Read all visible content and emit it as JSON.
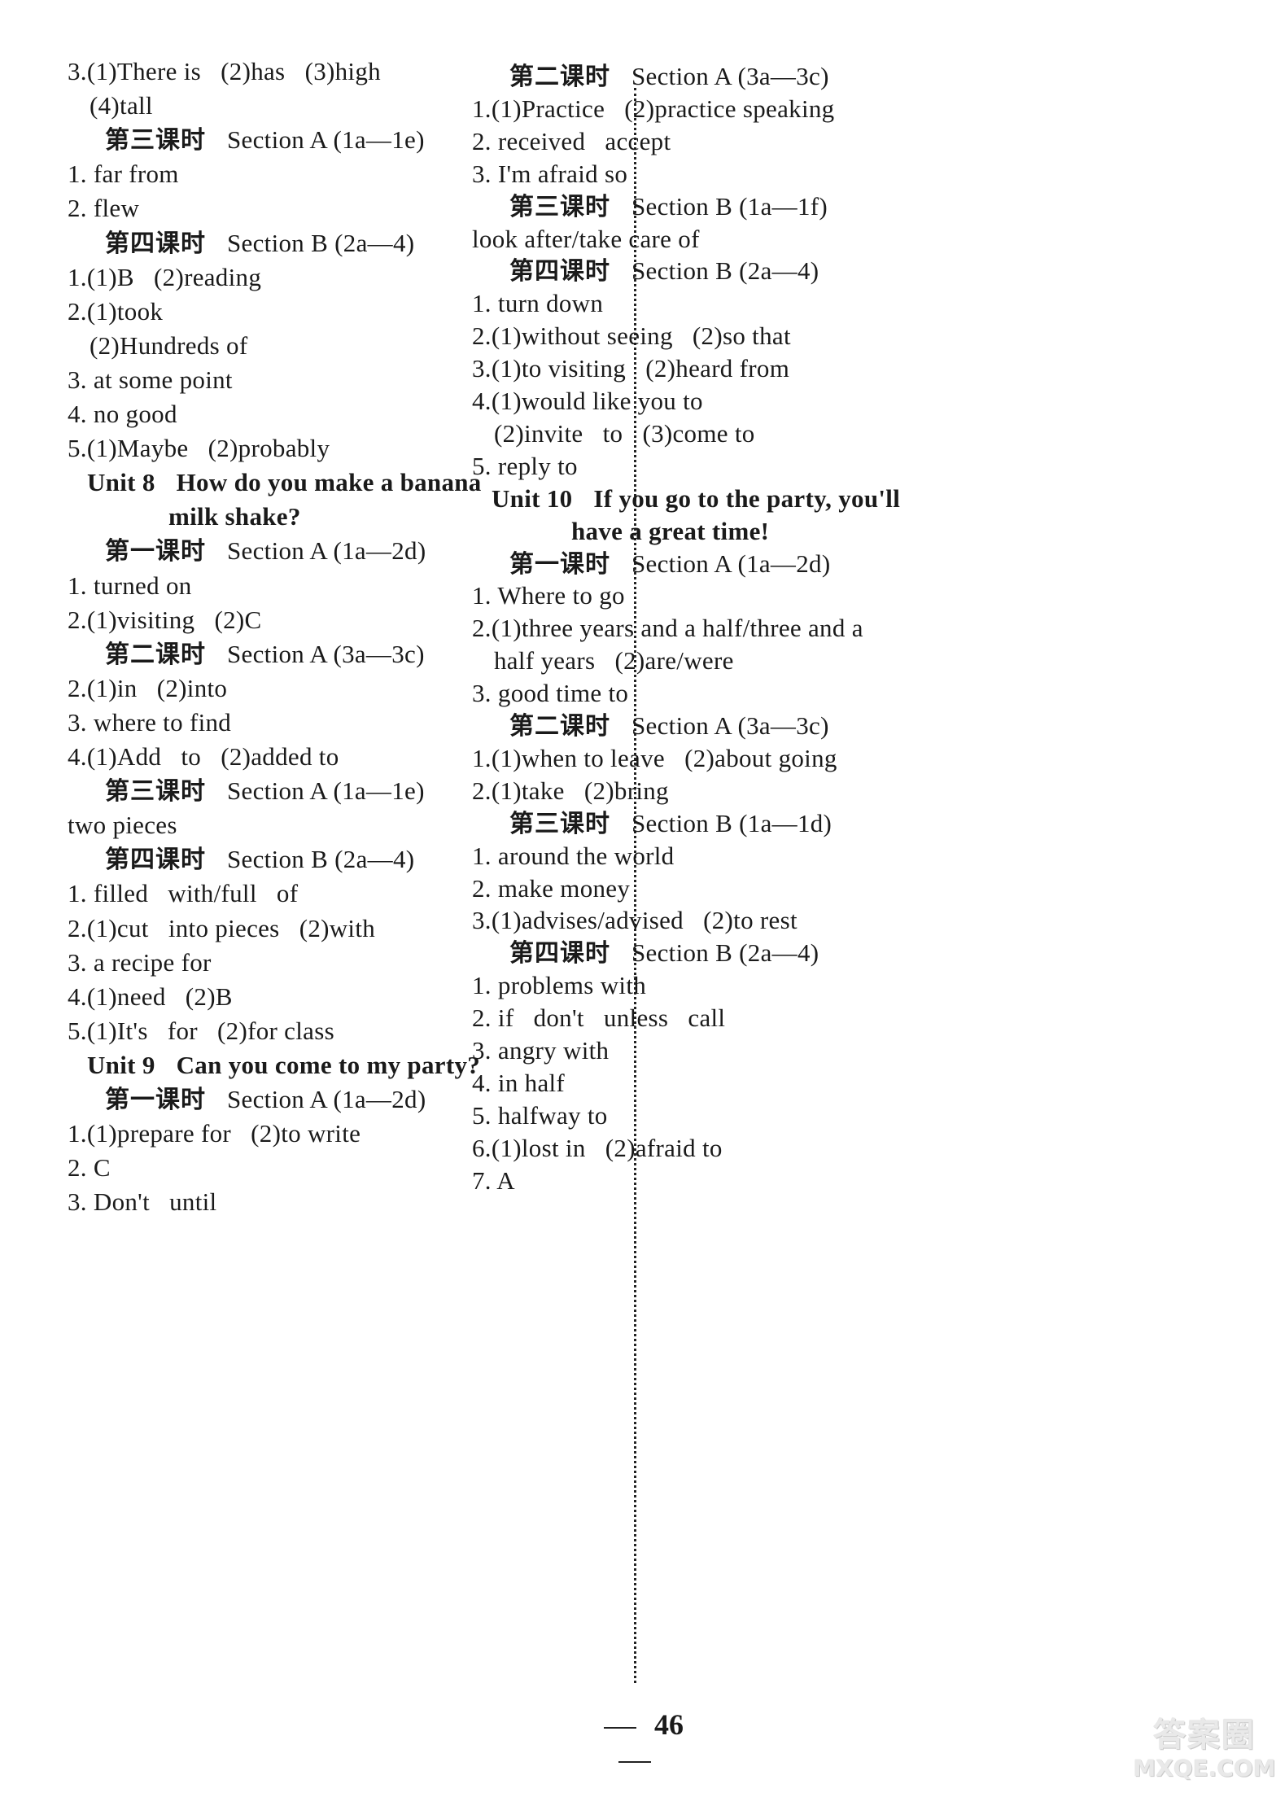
{
  "page_number": "46",
  "watermark": {
    "chinese": "答案圈",
    "domain": "MXQE.COM"
  },
  "left_column": [
    {
      "type": "item",
      "text": "3.(1)There is   (2)has   (3)high"
    },
    {
      "type": "item-cont",
      "text": "(4)tall"
    },
    {
      "type": "lesson",
      "cn": "第三课时",
      "en": "Section A (1a—1e)"
    },
    {
      "type": "item",
      "text": "1. far from"
    },
    {
      "type": "item",
      "text": "2. flew"
    },
    {
      "type": "lesson",
      "cn": "第四课时",
      "en": "Section B (2a—4)"
    },
    {
      "type": "item",
      "text": "1.(1)B   (2)reading"
    },
    {
      "type": "item",
      "text": "2.(1)took"
    },
    {
      "type": "item-cont",
      "text": "(2)Hundreds of"
    },
    {
      "type": "item",
      "text": "3. at some point"
    },
    {
      "type": "item",
      "text": "4. no good"
    },
    {
      "type": "item",
      "text": "5.(1)Maybe   (2)probably"
    },
    {
      "type": "unit",
      "num": "Unit 8",
      "title": "How do you make a banana"
    },
    {
      "type": "unit-cont",
      "title": "milk shake?"
    },
    {
      "type": "lesson",
      "cn": "第一课时",
      "en": "Section A (1a—2d)"
    },
    {
      "type": "item",
      "text": "1. turned on"
    },
    {
      "type": "item",
      "text": "2.(1)visiting   (2)C"
    },
    {
      "type": "lesson",
      "cn": "第二课时",
      "en": "Section A (3a—3c)"
    },
    {
      "type": "item",
      "text": "2.(1)in   (2)into"
    },
    {
      "type": "item",
      "text": "3. where to find"
    },
    {
      "type": "item",
      "text": "4.(1)Add   to   (2)added to"
    },
    {
      "type": "lesson",
      "cn": "第三课时",
      "en": "Section A (1a—1e)"
    },
    {
      "type": "item",
      "text": "two pieces"
    },
    {
      "type": "lesson",
      "cn": "第四课时",
      "en": "Section B (2a—4)"
    },
    {
      "type": "item",
      "text": "1. filled   with/full   of"
    },
    {
      "type": "item",
      "text": "2.(1)cut   into pieces   (2)with"
    },
    {
      "type": "item",
      "text": "3. a recipe for"
    },
    {
      "type": "item",
      "text": "4.(1)need   (2)B"
    },
    {
      "type": "item",
      "text": "5.(1)It's   for   (2)for class"
    },
    {
      "type": "unit",
      "num": "Unit 9",
      "title": "Can you come to my party?"
    },
    {
      "type": "lesson",
      "cn": "第一课时",
      "en": "Section A (1a—2d)"
    },
    {
      "type": "item",
      "text": "1.(1)prepare for   (2)to write"
    },
    {
      "type": "item",
      "text": "2. C"
    },
    {
      "type": "item",
      "text": "3. Don't   until"
    }
  ],
  "right_column": [
    {
      "type": "lesson",
      "cn": "第二课时",
      "en": "Section A (3a—3c)"
    },
    {
      "type": "item",
      "text": "1.(1)Practice   (2)practice speaking"
    },
    {
      "type": "item",
      "text": "2. received   accept"
    },
    {
      "type": "item",
      "text": "3. I'm afraid so"
    },
    {
      "type": "lesson",
      "cn": "第三课时",
      "en": "Section B (1a—1f)"
    },
    {
      "type": "item",
      "text": "look after/take care of"
    },
    {
      "type": "lesson",
      "cn": "第四课时",
      "en": "Section B (2a—4)"
    },
    {
      "type": "item",
      "text": "1. turn down"
    },
    {
      "type": "item",
      "text": "2.(1)without seeing   (2)so that"
    },
    {
      "type": "item",
      "text": "3.(1)to visiting   (2)heard from"
    },
    {
      "type": "item",
      "text": "4.(1)would like you to"
    },
    {
      "type": "item-cont",
      "text": "(2)invite   to   (3)come to"
    },
    {
      "type": "item",
      "text": "5. reply to"
    },
    {
      "type": "unit",
      "num": "Unit 10",
      "title": "If you go to the party, you'll"
    },
    {
      "type": "unit-cont",
      "title": "have a great time!"
    },
    {
      "type": "lesson",
      "cn": "第一课时",
      "en": "Section A (1a—2d)"
    },
    {
      "type": "item",
      "text": "1. Where to go"
    },
    {
      "type": "item",
      "text": "2.(1)three years and a half/three and a"
    },
    {
      "type": "item-cont",
      "text": "half years   (2)are/were"
    },
    {
      "type": "item",
      "text": "3. good time to"
    },
    {
      "type": "lesson",
      "cn": "第二课时",
      "en": "Section A (3a—3c)"
    },
    {
      "type": "item",
      "text": "1.(1)when to leave   (2)about going"
    },
    {
      "type": "item",
      "text": "2.(1)take   (2)bring"
    },
    {
      "type": "lesson",
      "cn": "第三课时",
      "en": "Section B (1a—1d)"
    },
    {
      "type": "item",
      "text": "1. around the world"
    },
    {
      "type": "item",
      "text": "2. make money"
    },
    {
      "type": "item",
      "text": "3.(1)advises/advised   (2)to rest"
    },
    {
      "type": "lesson",
      "cn": "第四课时",
      "en": "Section B (2a—4)"
    },
    {
      "type": "item",
      "text": "1. problems with"
    },
    {
      "type": "item",
      "text": "2. if   don't   unless   call"
    },
    {
      "type": "item",
      "text": "3. angry with"
    },
    {
      "type": "item",
      "text": "4. in half"
    },
    {
      "type": "item",
      "text": "5. halfway to"
    },
    {
      "type": "item",
      "text": "6.(1)lost in   (2)afraid to"
    },
    {
      "type": "item",
      "text": "7. A"
    }
  ]
}
